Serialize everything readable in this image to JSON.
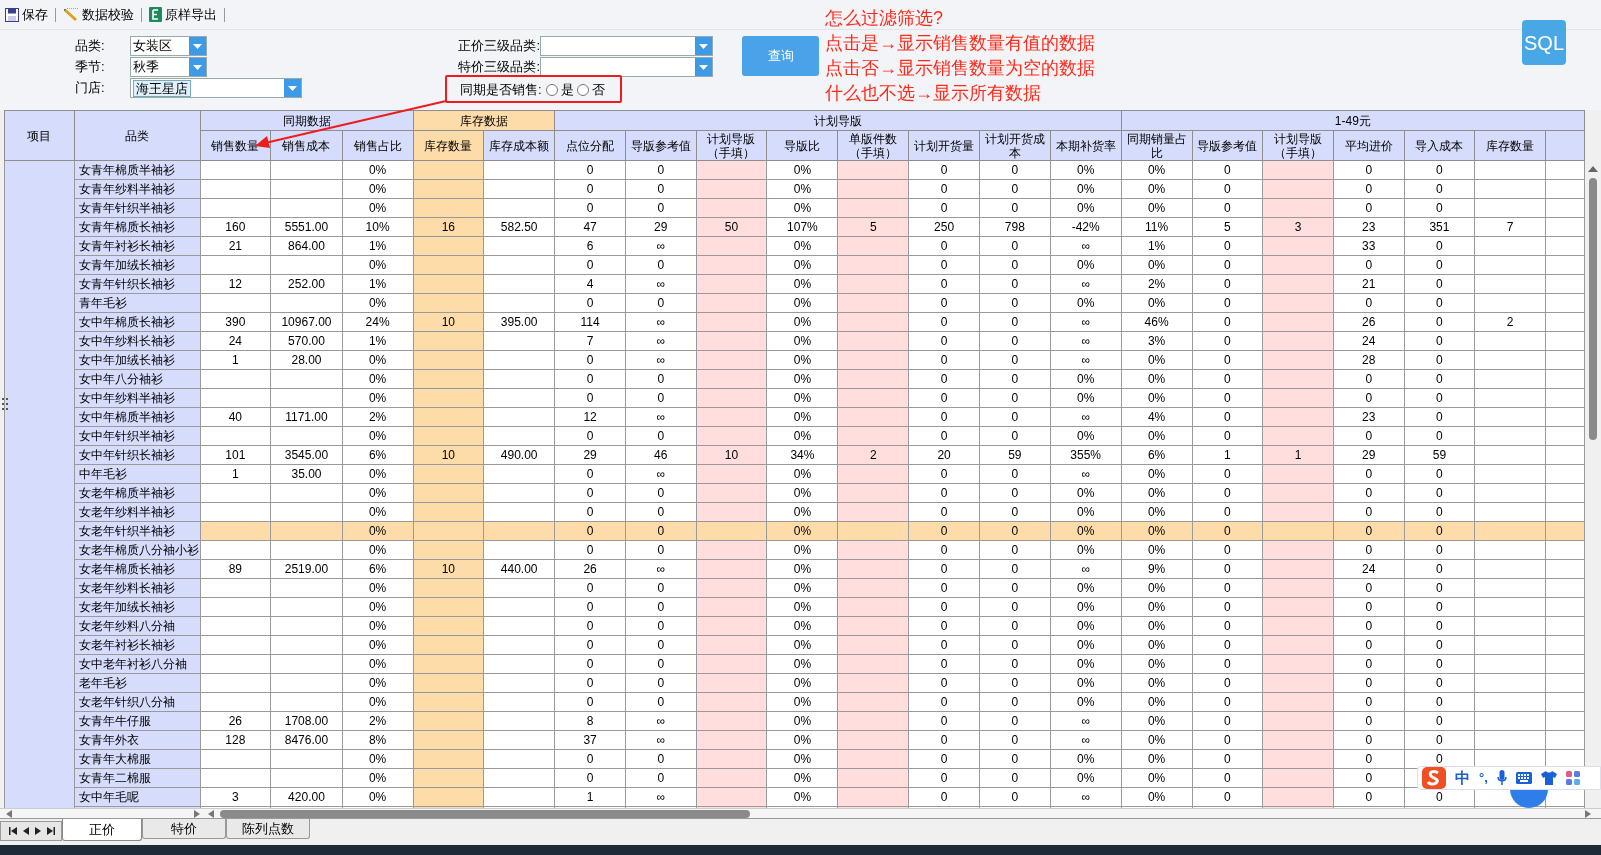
{
  "toolbar": [
    {
      "label": "保存",
      "kind": "save"
    },
    {
      "label": "数据校验",
      "kind": "check"
    },
    {
      "label": "原样导出",
      "kind": "export"
    }
  ],
  "filters_left": [
    {
      "label": "品类:",
      "value": "女装区",
      "kind": "short"
    },
    {
      "label": "季节:",
      "value": "秋季",
      "kind": "short"
    },
    {
      "label": "门店:",
      "value": "海王星店",
      "kind": "tag"
    }
  ],
  "filters_right": [
    {
      "label": "正价三级品类:"
    },
    {
      "label": "特价三级品类:"
    }
  ],
  "same_period_sales": {
    "label": "同期是否销售:",
    "options": [
      {
        "label": "是",
        "selected": false
      },
      {
        "label": "否",
        "selected": false
      }
    ]
  },
  "query_button": "查询",
  "sql_button": "SQL",
  "annotation": {
    "lines": [
      "怎么过滤筛选?",
      "点击是→显示销售数量有值的数据",
      "点击否→显示销售数量为空的数据",
      "什么也不选→显示所有数据"
    ]
  },
  "table": {
    "fixed_headers": [
      "项目",
      "品类"
    ],
    "groups": [
      {
        "label": "同期数据",
        "kind": "plain",
        "columns": [
          {
            "label": "销售数量",
            "kind": "plain"
          },
          {
            "label": "销售成本",
            "kind": "plain"
          },
          {
            "label": "销售占比",
            "kind": "plain"
          }
        ]
      },
      {
        "label": "库存数据",
        "kind": "stock",
        "columns": [
          {
            "label": "库存数量",
            "kind": "stock"
          },
          {
            "label": "库存成本额",
            "kind": "plain"
          }
        ]
      },
      {
        "label": "计划导版",
        "kind": "plain",
        "columns": [
          {
            "label": "点位分配",
            "kind": "plain"
          },
          {
            "label": "导版参考值",
            "kind": "plain"
          },
          {
            "label": "计划导版（手填）",
            "kind": "input"
          },
          {
            "label": "导版比",
            "kind": "plain"
          },
          {
            "label": "单版件数（手填）",
            "kind": "input"
          },
          {
            "label": "计划开货量",
            "kind": "plain"
          },
          {
            "label": "计划开货成本",
            "kind": "plain"
          },
          {
            "label": "本期补货率",
            "kind": "plain"
          }
        ]
      },
      {
        "label": "1-49元",
        "kind": "plain",
        "columns": [
          {
            "label": "同期销量占比",
            "kind": "plain"
          },
          {
            "label": "导版参考值",
            "kind": "plain"
          },
          {
            "label": "计划导版（手填）",
            "kind": "input"
          },
          {
            "label": "平均进价",
            "kind": "plain"
          },
          {
            "label": "导入成本",
            "kind": "plain"
          },
          {
            "label": "库存数量",
            "kind": "plain"
          }
        ]
      }
    ],
    "rows": [
      {
        "category": "女青年棉质半袖衫",
        "selected": false,
        "cells": [
          null,
          null,
          "0%",
          null,
          null,
          "0",
          "0",
          null,
          "0%",
          null,
          "0",
          "0",
          "0%",
          "0%",
          "0",
          null,
          "0",
          "0",
          null
        ]
      },
      {
        "category": "女青年纱料半袖衫",
        "selected": false,
        "cells": [
          null,
          null,
          "0%",
          null,
          null,
          "0",
          "0",
          null,
          "0%",
          null,
          "0",
          "0",
          "0%",
          "0%",
          "0",
          null,
          "0",
          "0",
          null
        ]
      },
      {
        "category": "女青年针织半袖衫",
        "selected": false,
        "cells": [
          null,
          null,
          "0%",
          null,
          null,
          "0",
          "0",
          null,
          "0%",
          null,
          "0",
          "0",
          "0%",
          "0%",
          "0",
          null,
          "0",
          "0",
          null
        ]
      },
      {
        "category": "女青年棉质长袖衫",
        "selected": false,
        "cells": [
          "160",
          "5551.00",
          "10%",
          "16",
          "582.50",
          "47",
          "29",
          "50",
          "107%",
          "5",
          "250",
          "798",
          "-42%",
          "11%",
          "5",
          "3",
          "23",
          "351",
          "7"
        ]
      },
      {
        "category": "女青年衬衫长袖衫",
        "selected": false,
        "cells": [
          "21",
          "864.00",
          "1%",
          null,
          null,
          "6",
          "∞",
          null,
          "0%",
          null,
          "0",
          "0",
          "∞",
          "1%",
          "0",
          null,
          "33",
          "0",
          null
        ]
      },
      {
        "category": "女青年加绒长袖衫",
        "selected": false,
        "cells": [
          null,
          null,
          "0%",
          null,
          null,
          "0",
          "0",
          null,
          "0%",
          null,
          "0",
          "0",
          "0%",
          "0%",
          "0",
          null,
          "0",
          "0",
          null
        ]
      },
      {
        "category": "女青年针织长袖衫",
        "selected": false,
        "cells": [
          "12",
          "252.00",
          "1%",
          null,
          null,
          "4",
          "∞",
          null,
          "0%",
          null,
          "0",
          "0",
          "∞",
          "2%",
          "0",
          null,
          "21",
          "0",
          null
        ]
      },
      {
        "category": "青年毛衫",
        "selected": false,
        "cells": [
          null,
          null,
          "0%",
          null,
          null,
          "0",
          "0",
          null,
          "0%",
          null,
          "0",
          "0",
          "0%",
          "0%",
          "0",
          null,
          "0",
          "0",
          null
        ]
      },
      {
        "category": "女中年棉质长袖衫",
        "selected": false,
        "cells": [
          "390",
          "10967.00",
          "24%",
          "10",
          "395.00",
          "114",
          "∞",
          null,
          "0%",
          null,
          "0",
          "0",
          "∞",
          "46%",
          "0",
          null,
          "26",
          "0",
          "2"
        ]
      },
      {
        "category": "女中年纱料长袖衫",
        "selected": false,
        "cells": [
          "24",
          "570.00",
          "1%",
          null,
          null,
          "7",
          "∞",
          null,
          "0%",
          null,
          "0",
          "0",
          "∞",
          "3%",
          "0",
          null,
          "24",
          "0",
          null
        ]
      },
      {
        "category": "女中年加绒长袖衫",
        "selected": false,
        "cells": [
          "1",
          "28.00",
          "0%",
          null,
          null,
          "0",
          "∞",
          null,
          "0%",
          null,
          "0",
          "0",
          "∞",
          "0%",
          "0",
          null,
          "28",
          "0",
          null
        ]
      },
      {
        "category": "女中年八分袖衫",
        "selected": false,
        "cells": [
          null,
          null,
          "0%",
          null,
          null,
          "0",
          "0",
          null,
          "0%",
          null,
          "0",
          "0",
          "0%",
          "0%",
          "0",
          null,
          "0",
          "0",
          null
        ]
      },
      {
        "category": "女中年纱料半袖衫",
        "selected": false,
        "cells": [
          null,
          null,
          "0%",
          null,
          null,
          "0",
          "0",
          null,
          "0%",
          null,
          "0",
          "0",
          "0%",
          "0%",
          "0",
          null,
          "0",
          "0",
          null
        ]
      },
      {
        "category": "女中年棉质半袖衫",
        "selected": false,
        "cells": [
          "40",
          "1171.00",
          "2%",
          null,
          null,
          "12",
          "∞",
          null,
          "0%",
          null,
          "0",
          "0",
          "∞",
          "4%",
          "0",
          null,
          "23",
          "0",
          null
        ]
      },
      {
        "category": "女中年针织半袖衫",
        "selected": false,
        "cells": [
          null,
          null,
          "0%",
          null,
          null,
          "0",
          "0",
          null,
          "0%",
          null,
          "0",
          "0",
          "0%",
          "0%",
          "0",
          null,
          "0",
          "0",
          null
        ]
      },
      {
        "category": "女中年针织长袖衫",
        "selected": false,
        "cells": [
          "101",
          "3545.00",
          "6%",
          "10",
          "490.00",
          "29",
          "46",
          "10",
          "34%",
          "2",
          "20",
          "59",
          "355%",
          "6%",
          "1",
          "1",
          "29",
          "59",
          null
        ]
      },
      {
        "category": "中年毛衫",
        "selected": false,
        "cells": [
          "1",
          "35.00",
          "0%",
          null,
          null,
          "0",
          "∞",
          null,
          "0%",
          null,
          "0",
          "0",
          "∞",
          "0%",
          "0",
          null,
          "0",
          "0",
          null
        ]
      },
      {
        "category": "女老年棉质半袖衫",
        "selected": false,
        "cells": [
          null,
          null,
          "0%",
          null,
          null,
          "0",
          "0",
          null,
          "0%",
          null,
          "0",
          "0",
          "0%",
          "0%",
          "0",
          null,
          "0",
          "0",
          null
        ]
      },
      {
        "category": "女老年纱料半袖衫",
        "selected": false,
        "cells": [
          null,
          null,
          "0%",
          null,
          null,
          "0",
          "0",
          null,
          "0%",
          null,
          "0",
          "0",
          "0%",
          "0%",
          "0",
          null,
          "0",
          "0",
          null
        ]
      },
      {
        "category": "女老年针织半袖衫",
        "selected": true,
        "cells": [
          null,
          null,
          "0%",
          null,
          null,
          "0",
          "0",
          null,
          "0%",
          null,
          "0",
          "0",
          "0%",
          "0%",
          "0",
          null,
          "0",
          "0",
          null
        ]
      },
      {
        "category": "女老年棉质八分袖小衫",
        "selected": false,
        "cells": [
          null,
          null,
          "0%",
          null,
          null,
          "0",
          "0",
          null,
          "0%",
          null,
          "0",
          "0",
          "0%",
          "0%",
          "0",
          null,
          "0",
          "0",
          null
        ]
      },
      {
        "category": "女老年棉质长袖衫",
        "selected": false,
        "cells": [
          "89",
          "2519.00",
          "6%",
          "10",
          "440.00",
          "26",
          "∞",
          null,
          "0%",
          null,
          "0",
          "0",
          "∞",
          "9%",
          "0",
          null,
          "24",
          "0",
          null
        ]
      },
      {
        "category": "女老年纱料长袖衫",
        "selected": false,
        "cells": [
          null,
          null,
          "0%",
          null,
          null,
          "0",
          "0",
          null,
          "0%",
          null,
          "0",
          "0",
          "0%",
          "0%",
          "0",
          null,
          "0",
          "0",
          null
        ]
      },
      {
        "category": "女老年加绒长袖衫",
        "selected": false,
        "cells": [
          null,
          null,
          "0%",
          null,
          null,
          "0",
          "0",
          null,
          "0%",
          null,
          "0",
          "0",
          "0%",
          "0%",
          "0",
          null,
          "0",
          "0",
          null
        ]
      },
      {
        "category": "女老年纱料八分袖",
        "selected": false,
        "cells": [
          null,
          null,
          "0%",
          null,
          null,
          "0",
          "0",
          null,
          "0%",
          null,
          "0",
          "0",
          "0%",
          "0%",
          "0",
          null,
          "0",
          "0",
          null
        ]
      },
      {
        "category": "女老年衬衫长袖衫",
        "selected": false,
        "cells": [
          null,
          null,
          "0%",
          null,
          null,
          "0",
          "0",
          null,
          "0%",
          null,
          "0",
          "0",
          "0%",
          "0%",
          "0",
          null,
          "0",
          "0",
          null
        ]
      },
      {
        "category": "女中老年衬衫八分袖",
        "selected": false,
        "cells": [
          null,
          null,
          "0%",
          null,
          null,
          "0",
          "0",
          null,
          "0%",
          null,
          "0",
          "0",
          "0%",
          "0%",
          "0",
          null,
          "0",
          "0",
          null
        ]
      },
      {
        "category": "老年毛衫",
        "selected": false,
        "cells": [
          null,
          null,
          "0%",
          null,
          null,
          "0",
          "0",
          null,
          "0%",
          null,
          "0",
          "0",
          "0%",
          "0%",
          "0",
          null,
          "0",
          "0",
          null
        ]
      },
      {
        "category": "女老年针织八分袖",
        "selected": false,
        "cells": [
          null,
          null,
          "0%",
          null,
          null,
          "0",
          "0",
          null,
          "0%",
          null,
          "0",
          "0",
          "0%",
          "0%",
          "0",
          null,
          "0",
          "0",
          null
        ]
      },
      {
        "category": "女青年牛仔服",
        "selected": false,
        "cells": [
          "26",
          "1708.00",
          "2%",
          null,
          null,
          "8",
          "∞",
          null,
          "0%",
          null,
          "0",
          "0",
          "∞",
          "0%",
          "0",
          null,
          "0",
          "0",
          null
        ]
      },
      {
        "category": "女青年外衣",
        "selected": false,
        "cells": [
          "128",
          "8476.00",
          "8%",
          null,
          null,
          "37",
          "∞",
          null,
          "0%",
          null,
          "0",
          "0",
          "∞",
          "0%",
          "0",
          null,
          "0",
          "0",
          null
        ]
      },
      {
        "category": "女青年大棉服",
        "selected": false,
        "cells": [
          null,
          null,
          "0%",
          null,
          null,
          "0",
          "0",
          null,
          "0%",
          null,
          "0",
          "0",
          "0%",
          "0%",
          "0",
          null,
          "0",
          "0",
          null
        ]
      },
      {
        "category": "女青年二棉服",
        "selected": false,
        "cells": [
          null,
          null,
          "0%",
          null,
          null,
          "0",
          "0",
          null,
          "0%",
          null,
          "0",
          "0",
          "0%",
          "0%",
          "0",
          null,
          "0",
          null,
          null
        ]
      },
      {
        "category": "女中年毛呢",
        "selected": false,
        "cells": [
          "3",
          "420.00",
          "0%",
          null,
          null,
          "1",
          "∞",
          null,
          "0%",
          null,
          "0",
          "0",
          "∞",
          "0%",
          "0",
          null,
          "0",
          "0",
          null
        ]
      }
    ]
  },
  "sheet_tabs": [
    {
      "label": "正价",
      "selected": true
    },
    {
      "label": "特价",
      "selected": false
    },
    {
      "label": "陈列点数",
      "selected": false
    }
  ],
  "ime_bar": {
    "language": "中",
    "punctuation": "°,"
  }
}
